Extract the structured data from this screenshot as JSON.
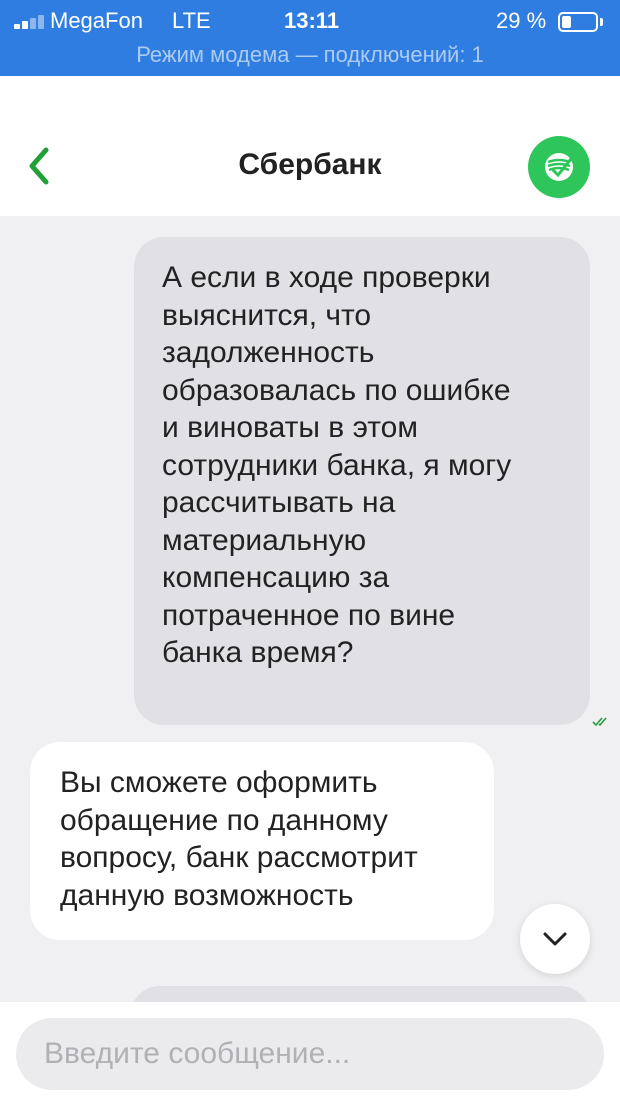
{
  "status_bar": {
    "carrier": "MegaFon",
    "network": "LTE",
    "time": "13:11",
    "battery": "29 %",
    "battery_level": 0.29,
    "hotspot": "Режим модема — подключений: 1",
    "color": "#2f7de1"
  },
  "header": {
    "title": "Сбербанк",
    "back_icon": "chevron-left-icon",
    "logo_icon": "sberbank-logo",
    "accent": "#21a038"
  },
  "messages": [
    {
      "direction": "outgoing",
      "lines": [
        "А если в ходе проверки",
        "выяснится, что",
        "задолженность",
        "образовалась по ошибке",
        "и виноваты в этом",
        "сотрудники банка, я могу",
        "рассчитывать на",
        "материальную",
        "компенсацию за",
        "потраченное по вине",
        "банка время?"
      ],
      "status_icon": "double-check-icon"
    },
    {
      "direction": "incoming",
      "lines": [
        "Вы сможете оформить",
        "обращение по данному",
        "вопросу, банк рассмотрит",
        "данную возможность"
      ]
    }
  ],
  "scroll_button_icon": "chevron-down-icon",
  "input": {
    "placeholder": "Введите сообщение..."
  }
}
